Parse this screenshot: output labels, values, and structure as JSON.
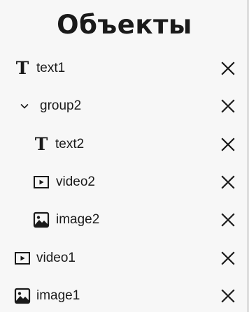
{
  "panel": {
    "title": "Объекты"
  },
  "items": [
    {
      "label": "text1",
      "icon": "text-icon"
    },
    {
      "label": "group2",
      "icon": "chevron-down-icon"
    },
    {
      "label": "text2",
      "icon": "text-icon"
    },
    {
      "label": "video2",
      "icon": "video-icon"
    },
    {
      "label": "image2",
      "icon": "image-icon"
    },
    {
      "label": "video1",
      "icon": "video-icon"
    },
    {
      "label": "image1",
      "icon": "image-icon"
    }
  ],
  "icons": {
    "text_glyph": "T",
    "remove": "close-icon"
  },
  "colors": {
    "background": "#f7f7f7",
    "text": "#1a1a1a",
    "border": "#dddddd"
  }
}
